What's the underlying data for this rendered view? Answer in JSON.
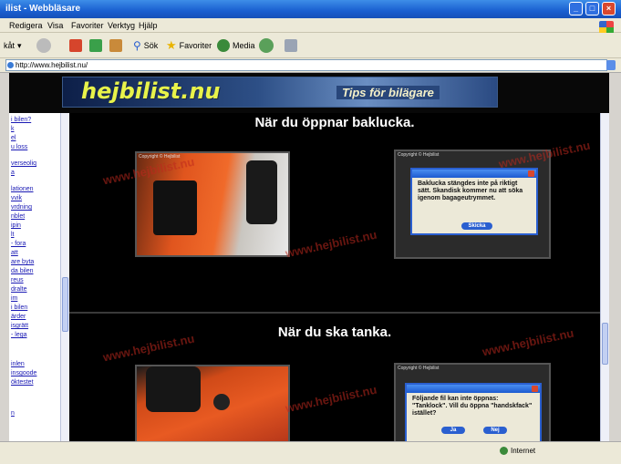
{
  "window": {
    "title": "ilist - Webbläsare"
  },
  "menu": [
    "Redigera",
    "Visa",
    "Favoriter",
    "Verktyg",
    "Hjälp"
  ],
  "toolbar": {
    "back_label": "kåt",
    "search_label": "Sök",
    "favorites_label": "Favoriter",
    "media_label": "Media"
  },
  "address": {
    "url": "http://www.hejbilist.nu/"
  },
  "banner": {
    "logo_text": "hejbilist.nu",
    "tagline": "Tips för bilägare"
  },
  "nav": {
    "links": [
      "i bilen?",
      "k",
      "el",
      "u loss",
      "verseoliq",
      "a",
      "lationen",
      "vvik",
      "vrdning",
      "nblet",
      "ipin",
      "lt",
      "- fora",
      "att",
      "are byta",
      "da bilen",
      "reus",
      "dralte",
      "im",
      "i bilen",
      "ärder",
      "isgrätt",
      "- lega",
      "inlen",
      "insgoode",
      "öktestet",
      "n"
    ]
  },
  "section1": {
    "heading": "När du öppnar baklucka.",
    "photo_caption": "Copyright © Hejbilist",
    "dialog_caption": "Copyright © Hejbilist",
    "dialog_text": "Baklucka stängdes inte på riktigt sätt. Skandisk kommer nu att söka igenom bagageutrymmet.",
    "dialog_button": "Skicka"
  },
  "section2": {
    "heading": "När du ska tanka.",
    "dialog_caption": "Copyright © Hejbilist",
    "dialog_text": "Följande fil kan inte öppnas: \"Tanklock\". Vill du öppna \"handskfack\" istället?",
    "yes_button": "Ja",
    "no_button": "Nej"
  },
  "watermark": "www.hejbilist.nu",
  "status": {
    "zone": "Internet"
  },
  "colors": {
    "accent": "#1a5fd0",
    "banner_text": "#e8f34a",
    "car": "#e0551e"
  }
}
